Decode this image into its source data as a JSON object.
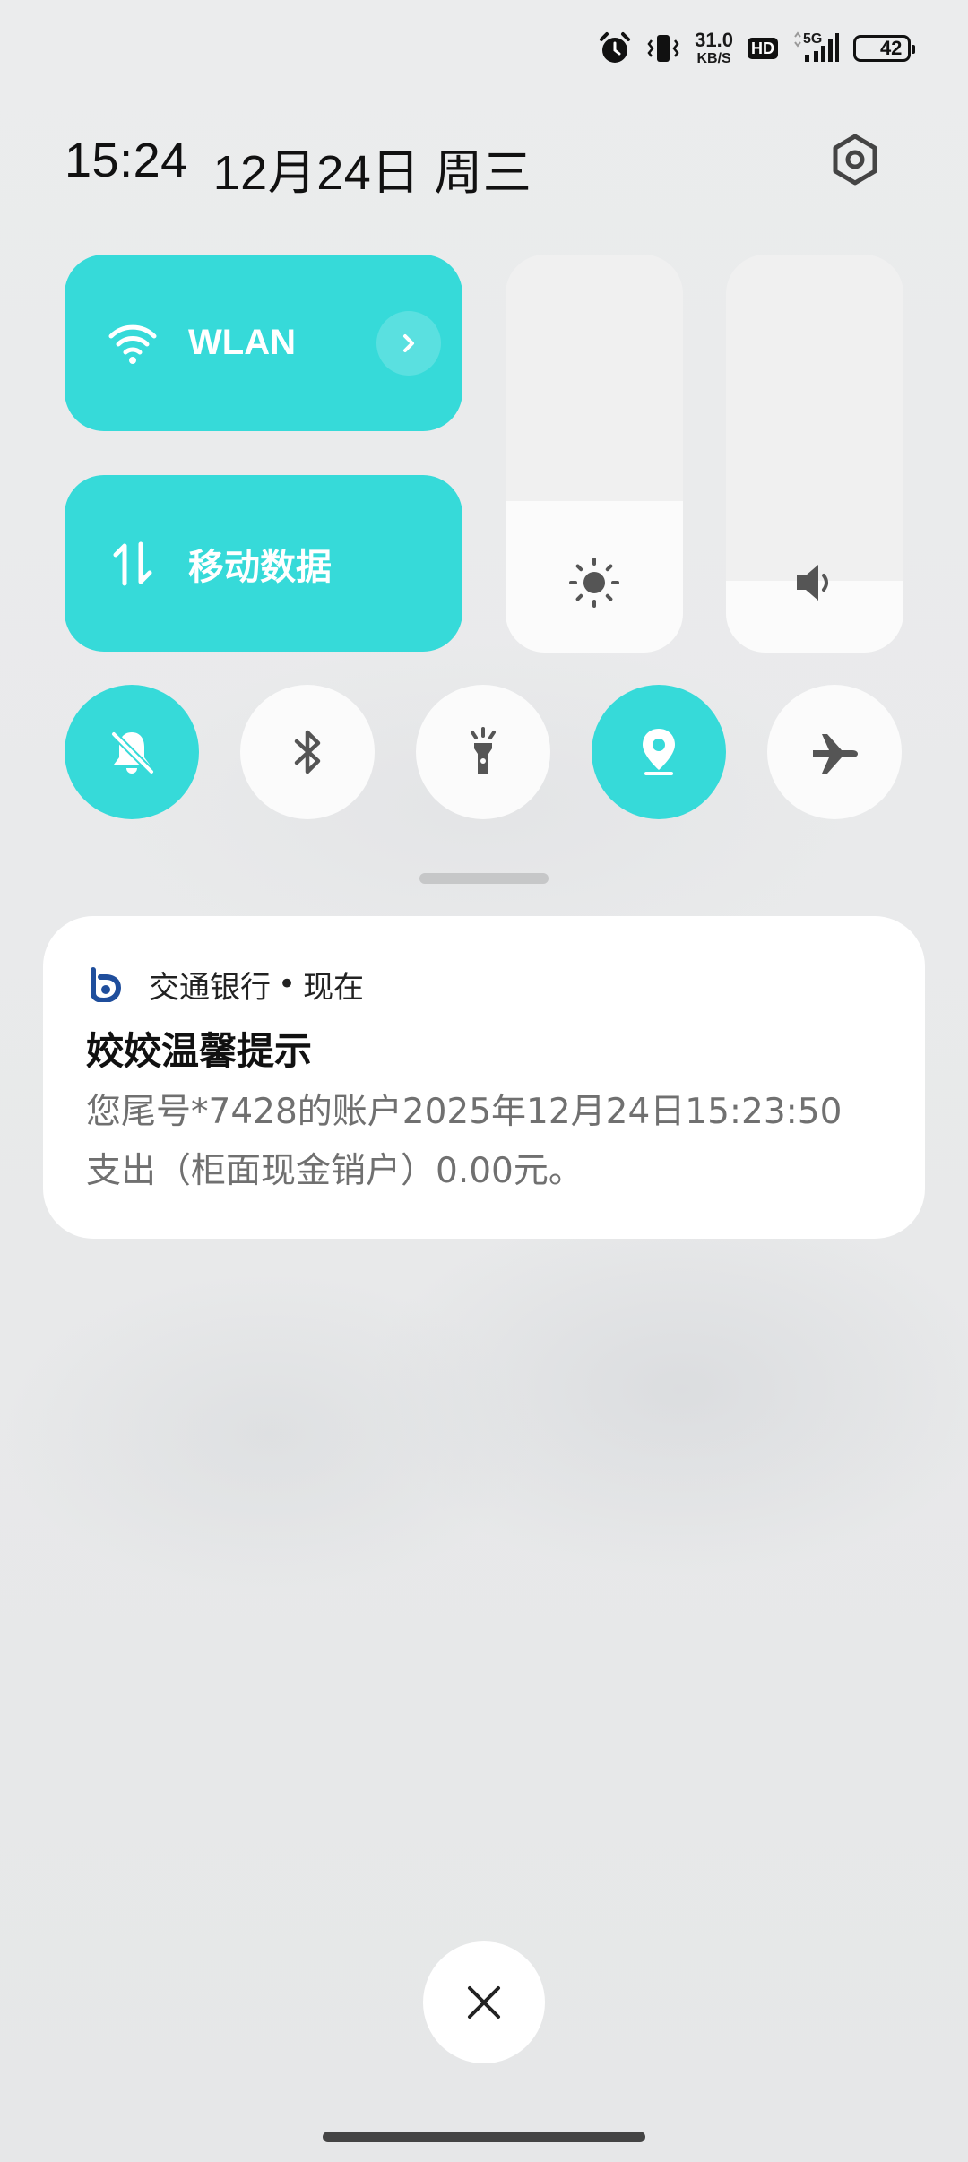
{
  "status_bar": {
    "net_speed_value": "31.0",
    "net_speed_unit": "KB/S",
    "hd_label": "HD",
    "network_type": "5G",
    "battery_level": "42",
    "icons": [
      "alarm-icon",
      "vibrate-icon",
      "signal-icon"
    ]
  },
  "header": {
    "time": "15:24",
    "date": "12月24日 周三"
  },
  "quick_settings": {
    "wlan": {
      "label": "WLAN",
      "on": true
    },
    "mobile_data": {
      "label": "移动数据",
      "on": true
    },
    "brightness_level": 0.38,
    "volume_level": 0.18,
    "toggles": [
      {
        "name": "mute",
        "icon": "bell-off-icon",
        "on": true
      },
      {
        "name": "bluetooth",
        "icon": "bluetooth-icon",
        "on": false
      },
      {
        "name": "flashlight",
        "icon": "flashlight-icon",
        "on": false
      },
      {
        "name": "location",
        "icon": "location-icon",
        "on": true
      },
      {
        "name": "airplane",
        "icon": "airplane-icon",
        "on": false
      }
    ]
  },
  "notification": {
    "app_name": "交通银行",
    "separator": "•",
    "time": "现在",
    "title": "姣姣温馨提示",
    "body": "您尾号*7428的账户2025年12月24日15:23:50\n支出（柜面现金销户）0.00元。"
  },
  "colors": {
    "accent": "#36dad9",
    "background": "#e8e9ea",
    "tile_off": "#fbfbfb",
    "icon_dark": "#555555"
  }
}
